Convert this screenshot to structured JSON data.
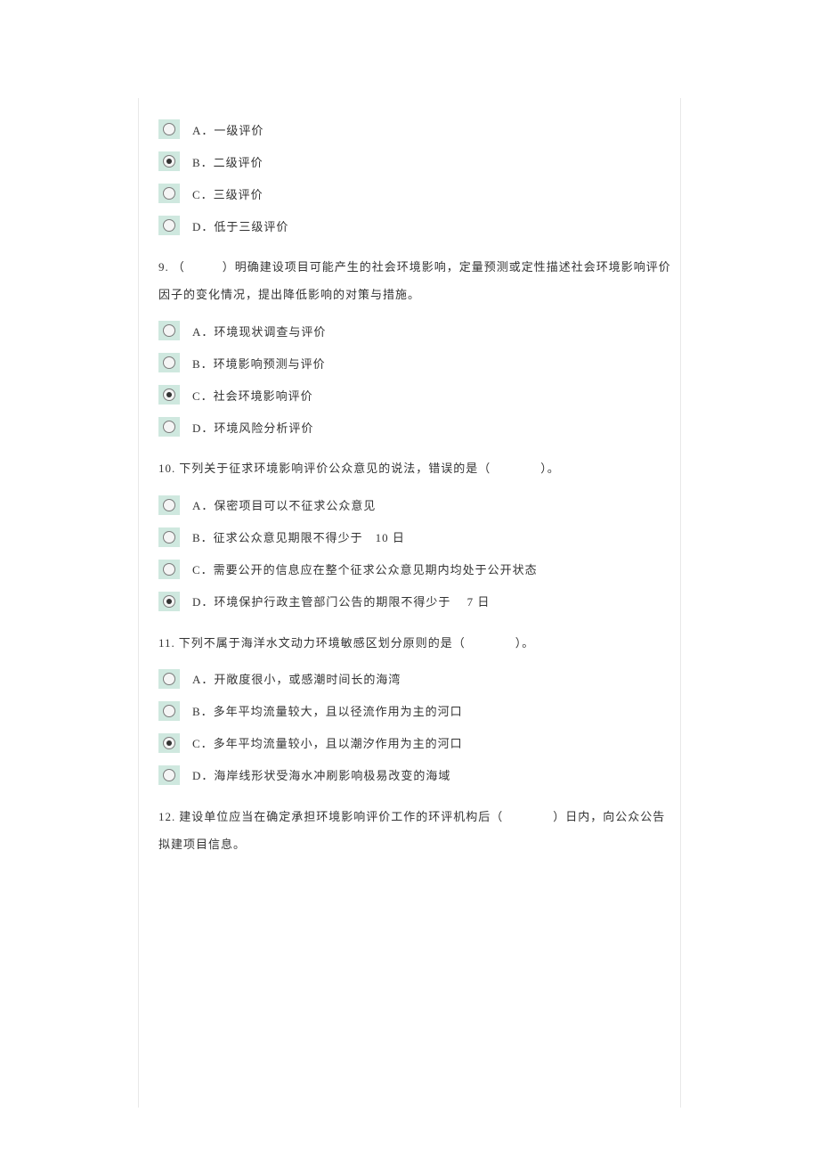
{
  "q8_options": {
    "a": "A．一级评价",
    "b": "B．二级评价",
    "c": "C．三级评价",
    "d": "D．低于三级评价"
  },
  "q9": {
    "num": "9.",
    "text": "（　　　）明确建设项目可能产生的社会环境影响，定量预测或定性描述社会环境影响评价因子的变化情况，提出降低影响的对策与措施。",
    "options": {
      "a": "A．环境现状调查与评价",
      "b": "B．环境影响预测与评价",
      "c": "C．社会环境影响评价",
      "d": "D．环境风险分析评价"
    }
  },
  "q10": {
    "num": "10.",
    "text": "下列关于征求环境影响评价公众意见的说法，错误的是（　　　　）。",
    "options": {
      "a": "A．保密项目可以不征求公众意见",
      "b": "B．征求公众意见期限不得少于　10 日",
      "c": "C．需要公开的信息应在整个征求公众意见期内均处于公开状态",
      "d": "D．环境保护行政主管部门公告的期限不得少于　 7 日"
    }
  },
  "q11": {
    "num": "11.",
    "text": "下列不属于海洋水文动力环境敏感区划分原则的是（　　　　）。",
    "options": {
      "a": "A．开敞度很小，或感潮时间长的海湾",
      "b": "B．多年平均流量较大，且以径流作用为主的河口",
      "c": "C．多年平均流量较小，且以潮汐作用为主的河口",
      "d": "D．海岸线形状受海水冲刷影响极易改变的海域"
    }
  },
  "q12": {
    "num": "12.",
    "text": "建设单位应当在确定承担环境影响评价工作的环评机构后（　　　　）日内，向公众公告拟建项目信息。"
  }
}
